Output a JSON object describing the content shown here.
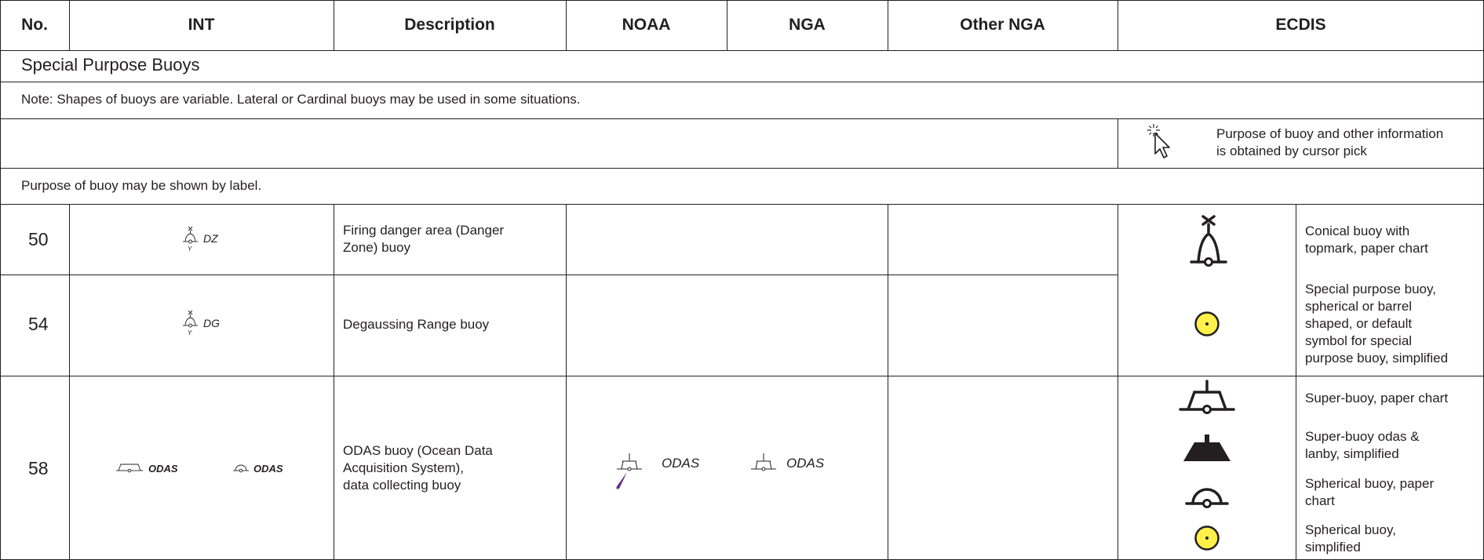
{
  "header": {
    "no": "No.",
    "int": "INT",
    "description": "Description",
    "noaa": "NOAA",
    "nga": "NGA",
    "other_nga": "Other NGA",
    "ecdis": "ECDIS"
  },
  "section": {
    "title": "Special Purpose Buoys",
    "note": "Note: Shapes of buoys are variable. Lateral or Cardinal buoys may be used in some situations.",
    "ecdis_pick_text": [
      "Purpose of buoy and other information",
      "is obtained by cursor pick"
    ],
    "label_note": "Purpose of buoy may be shown by label."
  },
  "rows": [
    {
      "no": "50",
      "int_label": "DZ",
      "description": [
        "Firing danger area (Danger",
        "Zone) buoy"
      ]
    },
    {
      "no": "54",
      "int_label": "DG",
      "description": [
        "Degaussing Range buoy"
      ]
    },
    {
      "no": "58",
      "int_labels": [
        "ODAS",
        "ODAS"
      ],
      "description": [
        "ODAS buoy (Ocean Data",
        "Acquisition System),",
        "data collecting buoy"
      ],
      "noaa_label": "ODAS",
      "nga_label": "ODAS"
    }
  ],
  "ecdis_symbols": [
    {
      "icon": "conical-buoy-topmark-icon",
      "text": [
        "Conical buoy with",
        "topmark, paper chart"
      ]
    },
    {
      "icon": "special-purpose-buoy-simplified-icon",
      "text": [
        "Special purpose buoy,",
        "spherical or barrel",
        "shaped, or default",
        "symbol for special",
        "purpose buoy, simplified"
      ]
    },
    {
      "icon": "super-buoy-paper-chart-icon",
      "text": [
        "Super-buoy, paper chart"
      ]
    },
    {
      "icon": "super-buoy-odas-simplified-icon",
      "text": [
        "Super-buoy odas &",
        "lanby, simplified"
      ]
    },
    {
      "icon": "spherical-buoy-paper-chart-icon",
      "text": [
        "Spherical buoy, paper",
        "chart"
      ]
    },
    {
      "icon": "spherical-buoy-simplified-icon",
      "text": [
        "Spherical buoy,",
        "simplified"
      ]
    }
  ],
  "colors": {
    "line": "#231f20",
    "simplified_fill": "#fff04a",
    "light_flare": "#6b2d86"
  }
}
